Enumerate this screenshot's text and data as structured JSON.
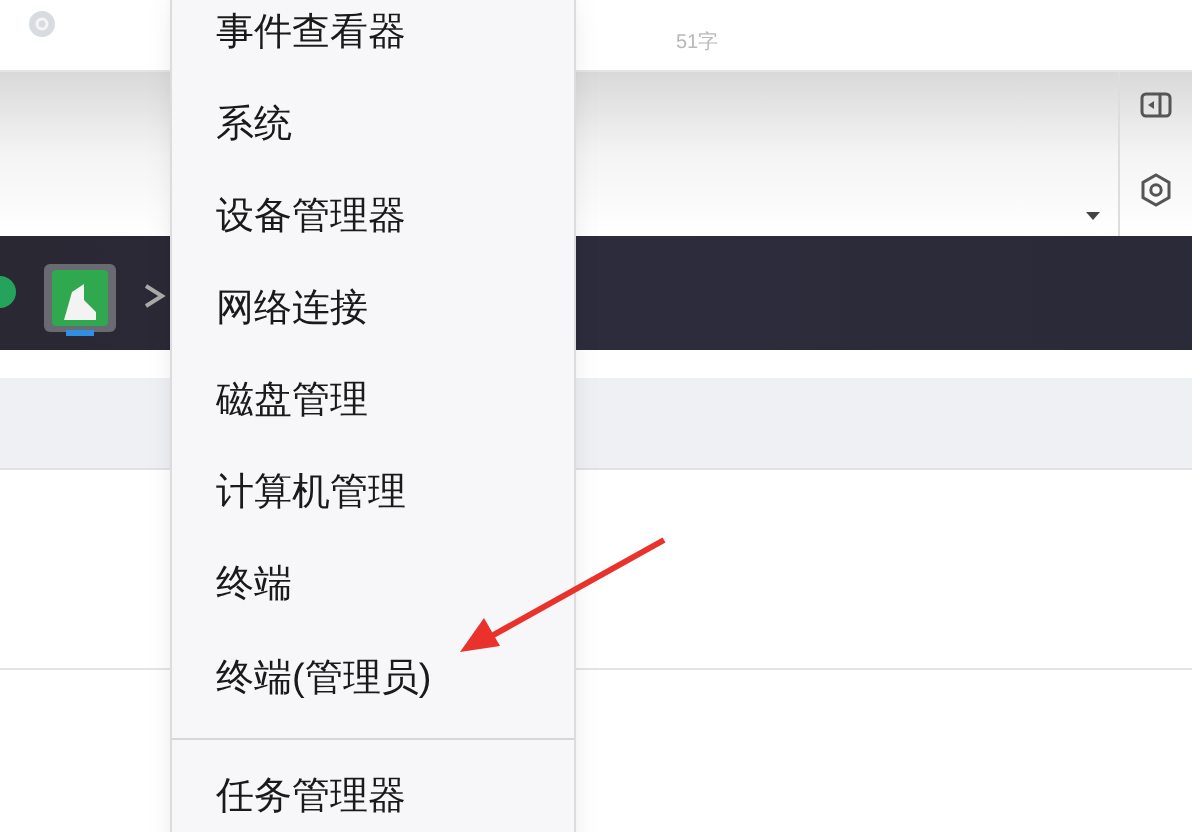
{
  "background_window": {
    "faint_label": "51字"
  },
  "context_menu": {
    "groups": [
      [
        "事件查看器",
        "系统",
        "设备管理器",
        "网络连接",
        "磁盘管理",
        "计算机管理",
        "终端",
        "终端(管理员)"
      ],
      [
        "任务管理器"
      ]
    ]
  }
}
